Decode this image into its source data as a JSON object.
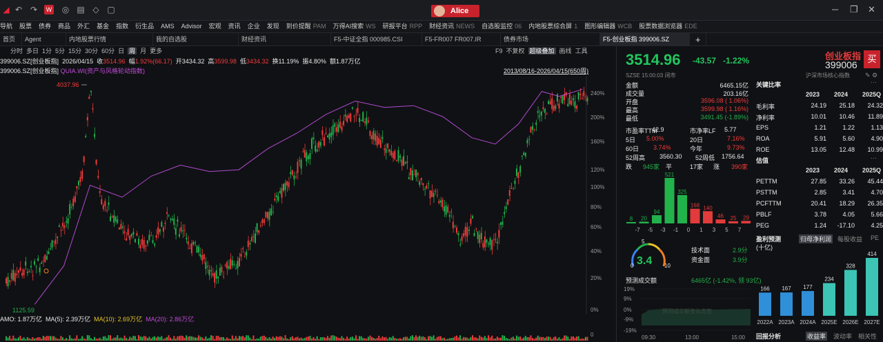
{
  "window": {
    "user": "Alice"
  },
  "menu": [
    "导航",
    "股票",
    "债券",
    "商品",
    "外汇",
    "基金",
    "指数",
    "衍生品",
    "AMS",
    "Advisor",
    "宏观",
    "资讯",
    "企业",
    "发现",
    "到价提醒",
    "PAM",
    "万得AI搜索",
    "WS",
    "研报平台",
    "RPP",
    "财经资讯",
    "NEWS",
    "自选股监控",
    "06",
    "内地股票综合屏",
    "1",
    "图形编辑器",
    "WCB",
    "股票数据浏览器",
    "EDE"
  ],
  "tabs": [
    "首页",
    "Agent",
    "内地股票行情",
    "我的自选股",
    "财经资讯",
    "F5-中证全指 000985.CSI",
    "F5-FR007 FR007.IR",
    "债券市场",
    "F5-创业板指 399006.SZ"
  ],
  "chart_toolbar": {
    "periods": [
      "分时",
      "多日",
      "1分",
      "5分",
      "15分",
      "30分",
      "60分",
      "日",
      "周",
      "月",
      "更多"
    ],
    "selected": "周",
    "right": [
      "F9",
      "不复权",
      "超级叠加",
      "画线",
      "工具"
    ]
  },
  "price_line": {
    "code": "399006.SZ[创业板指]",
    "date": "2026/04/15",
    "close_label": "收",
    "close": "3514.96",
    "change_label": "幅",
    "change": "1.92%(66.17)",
    "open_label": "开",
    "open": "3434.32",
    "high_label": "高",
    "high": "3599.98",
    "low_label": "低",
    "low": "3434.32",
    "turnover": "换11.19%",
    "amplitude": "振4.80%",
    "amount": "额1.87万亿"
  },
  "indicator_line": {
    "code": "399006.SZ[创业板指]",
    "overlay": "QUIA.WI(资产与风格轮动指数)",
    "range": "2013/08/16-2026/04/15(650周)"
  },
  "chart_data": {
    "type": "candlestick",
    "period": "weekly",
    "x_range": [
      "2013/08/16",
      "2026/04/15"
    ],
    "y_min_marker": "1125.59",
    "y_max_marker": "4037.96",
    "right_axis_ticks": [
      "240%",
      "200%",
      "160%",
      "120%",
      "100%",
      "80%",
      "60%",
      "40%",
      "20%",
      "0%"
    ],
    "series": [
      {
        "name": "399006.SZ",
        "color": "#f23b3b"
      },
      {
        "name": "QUIA.WI",
        "color": "#b04ad0"
      }
    ]
  },
  "volume_line": {
    "amo": "AMO: 1.87万亿",
    "ma5": "MA(5): 2.39万亿",
    "ma10": "MA(10): 2.69万亿",
    "ma20": "MA(20): 2.86万亿"
  },
  "quote": {
    "price": "3514.96",
    "change": "-43.57",
    "change_pct": "-1.22%",
    "name": "创业板指",
    "code": "399006",
    "buy": "买",
    "exchange_time": "SZSE 15:00:03 闭市",
    "related": "沪深市场核心指数",
    "rows": [
      {
        "label": "金额",
        "value": "6465.15亿"
      },
      {
        "label": "成交量",
        "value": "203.16亿"
      },
      {
        "label": "开盘",
        "value": "3596.08 ( 1.06%)"
      },
      {
        "label": "最高",
        "value": "3599.98 ( 1.16%)"
      },
      {
        "label": "最低",
        "value": "3491.45 (-1.89%)"
      }
    ],
    "pe_label": "市盈率TTM",
    "pe": "42.9",
    "pb_label": "市净率LF",
    "pb": "5.77",
    "d5_label": "5日",
    "d5": "5.00%",
    "d20_label": "20日",
    "d20": "7.16%",
    "d60_label": "60日",
    "d60": "3.74%",
    "ytd_label": "今年",
    "ytd": "9.73%",
    "h52_label": "52周高",
    "h52": "3560.30",
    "l52_label": "52周低",
    "l52": "1756.64",
    "down_label": "跌",
    "down": "945家",
    "flat_label": "平",
    "flat": "17家",
    "up_label": "涨",
    "up": "390家"
  },
  "distribution": {
    "labels": [
      "-7",
      "-5",
      "-3",
      "-1",
      "0",
      "1",
      "3",
      "5",
      "7"
    ],
    "values": [
      8,
      20,
      94,
      521,
      325,
      168,
      140,
      46,
      25,
      29
    ],
    "value_labels": [
      "8",
      "20",
      "94",
      "521",
      "325",
      "168",
      "140",
      "46",
      "25",
      "29"
    ]
  },
  "gauge": {
    "value": "3.4",
    "min": "0",
    "max": "10",
    "mid": "5",
    "tech_label": "技术面",
    "tech": "2.9分",
    "fund_label": "资金面",
    "fund": "3.9分"
  },
  "forecast": {
    "label": "预测成交额",
    "value": "6465亿 (-1.42%, 领 93亿)",
    "axis": [
      "19%",
      "9%",
      "0%",
      "-9%",
      "-19%"
    ],
    "times": [
      "09:30",
      "13:00",
      "15:00"
    ],
    "watermark": "预测成交额变化走势"
  },
  "ratios": {
    "title": "关键比率",
    "years": [
      "2023",
      "2024",
      "2025Q"
    ],
    "rows": [
      {
        "label": "毛利率",
        "v": [
          "24.19",
          "25.18",
          "24.32"
        ]
      },
      {
        "label": "净利率",
        "v": [
          "10.01",
          "10.46",
          "11.89"
        ]
      },
      {
        "label": "EPS",
        "v": [
          "1.21",
          "1.22",
          "1.13"
        ]
      },
      {
        "label": "ROA",
        "v": [
          "5.91",
          "5.60",
          "4.90"
        ]
      },
      {
        "label": "ROE",
        "v": [
          "13.05",
          "12.48",
          "10.99"
        ]
      }
    ]
  },
  "valuation": {
    "title": "估值",
    "years": [
      "2023",
      "2024",
      "2025Q"
    ],
    "rows": [
      {
        "label": "PETTM",
        "v": [
          "27.85",
          "33.26",
          "45.44"
        ]
      },
      {
        "label": "PSTTM",
        "v": [
          "2.85",
          "3.41",
          "4.70"
        ]
      },
      {
        "label": "PCFTTM",
        "v": [
          "20.41",
          "18.29",
          "26.35"
        ]
      },
      {
        "label": "PBLF",
        "v": [
          "3.78",
          "4.05",
          "5.66"
        ]
      },
      {
        "label": "PEG",
        "v": [
          "1.24",
          "-17.10",
          "4.25"
        ]
      }
    ]
  },
  "profit": {
    "title": "盈利预测",
    "tabs": [
      "归母净利润",
      "每股收益",
      "PE"
    ],
    "unit": "(十亿)",
    "years": [
      "2022A",
      "2023A",
      "2024A",
      "2025E",
      "2026E",
      "2027E"
    ],
    "values": [
      166,
      167,
      177,
      234,
      328,
      414
    ],
    "value_labels": [
      "166",
      "167",
      "177",
      "234",
      "328",
      "414"
    ]
  },
  "bottom": {
    "title": "回报分析",
    "tabs": [
      "收益率",
      "波动率",
      "相关性"
    ]
  }
}
